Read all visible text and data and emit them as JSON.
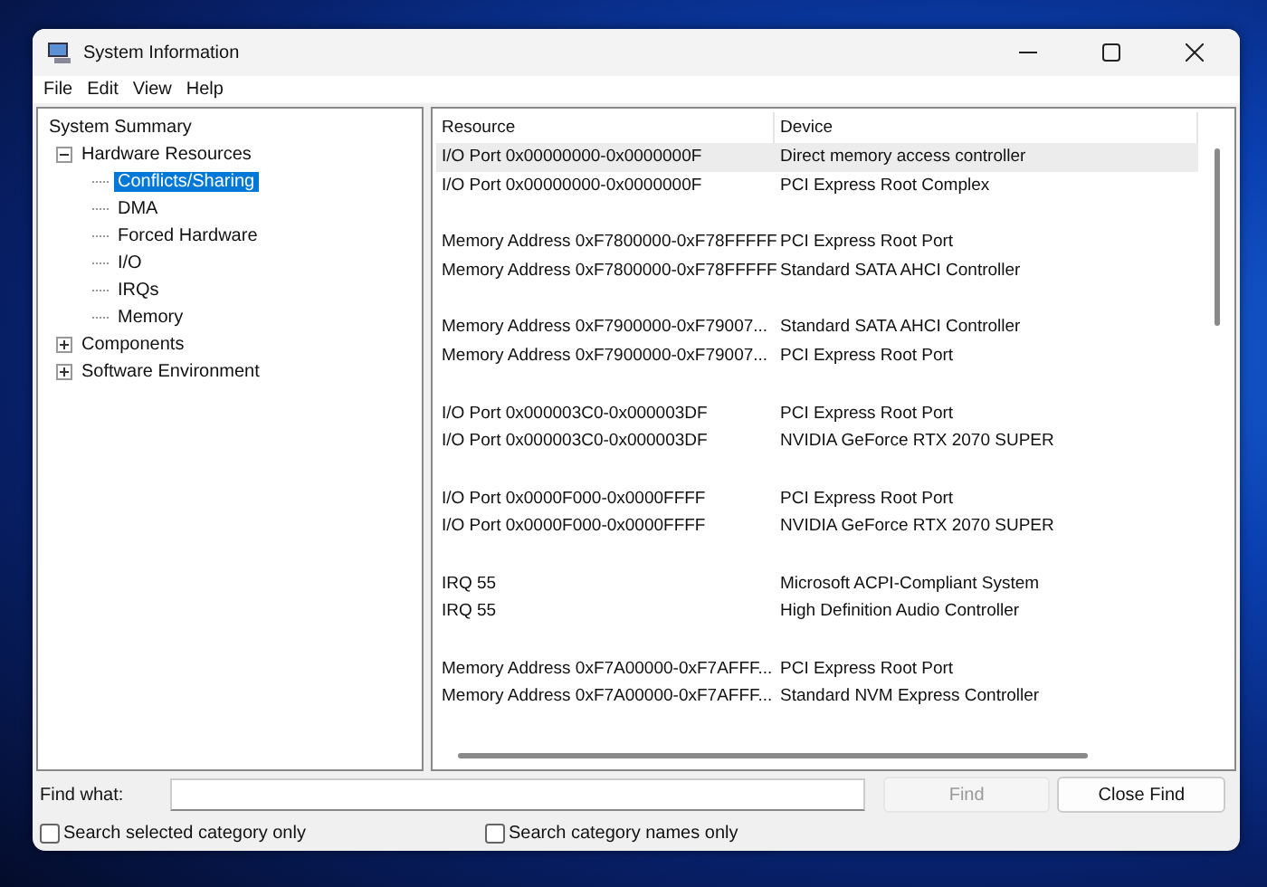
{
  "window": {
    "title": "System Information"
  },
  "menu": [
    "File",
    "Edit",
    "View",
    "Help"
  ],
  "tree": [
    {
      "label": "System Summary",
      "selected": false,
      "children": [
        {
          "label": "Hardware Resources",
          "expanded": true,
          "selected": false,
          "children": [
            {
              "label": "Conflicts/Sharing",
              "selected": true
            },
            {
              "label": "DMA",
              "selected": false
            },
            {
              "label": "Forced Hardware",
              "selected": false
            },
            {
              "label": "I/O",
              "selected": false
            },
            {
              "label": "IRQs",
              "selected": false
            },
            {
              "label": "Memory",
              "selected": false
            }
          ]
        },
        {
          "label": "Components",
          "expanded": false,
          "selected": false
        },
        {
          "label": "Software Environment",
          "expanded": false,
          "selected": false
        }
      ]
    }
  ],
  "table": {
    "columns": [
      "Resource",
      "Device"
    ],
    "groups": [
      {
        "rows": [
          {
            "resource": "I/O Port 0x00000000-0x0000000F",
            "device": "Direct memory access controller",
            "selected": true
          },
          {
            "resource": "I/O Port 0x00000000-0x0000000F",
            "device": "PCI Express Root Complex",
            "selected": false
          }
        ]
      },
      {
        "rows": [
          {
            "resource": "Memory Address 0xF7800000-0xF78FFFFF",
            "device": "PCI Express Root Port",
            "selected": false
          },
          {
            "resource": "Memory Address 0xF7800000-0xF78FFFFF",
            "device": "Standard SATA AHCI Controller",
            "selected": false
          }
        ]
      },
      {
        "rows": [
          {
            "resource": "Memory Address 0xF7900000-0xF79007...",
            "device": "Standard SATA AHCI Controller",
            "selected": false
          },
          {
            "resource": "Memory Address 0xF7900000-0xF79007...",
            "device": "PCI Express Root Port",
            "selected": false
          }
        ]
      },
      {
        "rows": [
          {
            "resource": "I/O Port 0x000003C0-0x000003DF",
            "device": "PCI Express Root Port",
            "selected": false
          },
          {
            "resource": "I/O Port 0x000003C0-0x000003DF",
            "device": "NVIDIA GeForce RTX 2070 SUPER",
            "selected": false
          }
        ]
      },
      {
        "rows": [
          {
            "resource": "I/O Port 0x0000F000-0x0000FFFF",
            "device": "PCI Express Root Port",
            "selected": false
          },
          {
            "resource": "I/O Port 0x0000F000-0x0000FFFF",
            "device": "NVIDIA GeForce RTX 2070 SUPER",
            "selected": false
          }
        ]
      },
      {
        "rows": [
          {
            "resource": "IRQ 55",
            "device": "Microsoft ACPI-Compliant System",
            "selected": false
          },
          {
            "resource": "IRQ 55",
            "device": "High Definition Audio Controller",
            "selected": false
          }
        ]
      },
      {
        "rows": [
          {
            "resource": "Memory Address 0xF7A00000-0xF7AFFF...",
            "device": "PCI Express Root Port",
            "selected": false
          },
          {
            "resource": "Memory Address 0xF7A00000-0xF7AFFF...",
            "device": "Standard NVM Express Controller",
            "selected": false
          }
        ]
      }
    ]
  },
  "find": {
    "label": "Find what:",
    "find_button": {
      "label": "Find",
      "disabled": true
    },
    "close_button": {
      "label": "Close Find",
      "disabled": false
    },
    "options": [
      {
        "label": "Search selected category only",
        "checked": false
      },
      {
        "label": "Search category names only",
        "checked": false
      }
    ]
  }
}
